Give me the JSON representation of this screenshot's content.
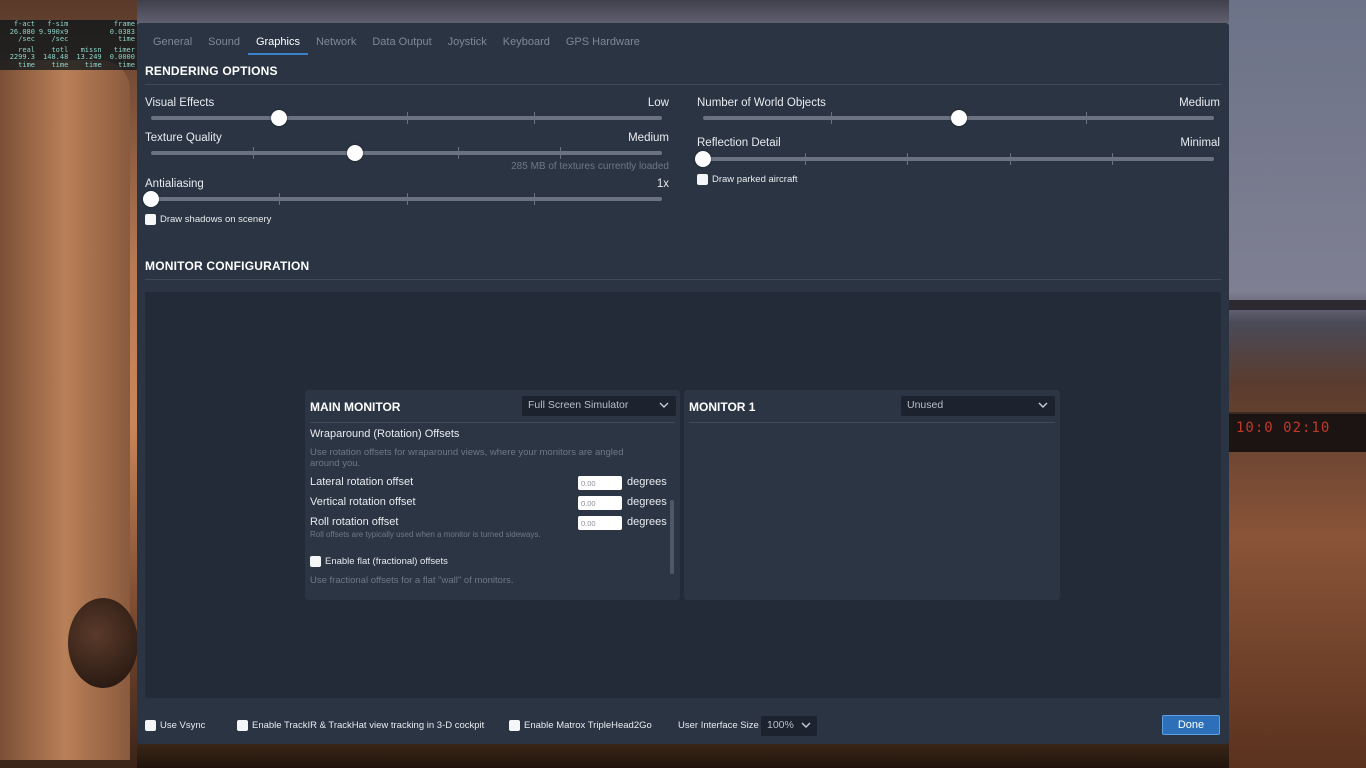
{
  "fps_overlay": {
    "rows": [
      [
        "f-act",
        "f-sim",
        "",
        "frame"
      ],
      [
        "26.080",
        "9.990x9",
        "",
        "0.0383"
      ],
      [
        "/sec",
        "/sec",
        "",
        "time"
      ],
      [
        "real",
        "totl",
        "missn",
        "timer"
      ],
      [
        "2299.3",
        "148.48",
        "13.249",
        "0.0000"
      ],
      [
        "time",
        "time",
        "time",
        "time"
      ]
    ]
  },
  "scene": {
    "readout": "10:0 02:10"
  },
  "tabs": [
    {
      "label": "General",
      "active": false
    },
    {
      "label": "Sound",
      "active": false
    },
    {
      "label": "Graphics",
      "active": true
    },
    {
      "label": "Network",
      "active": false
    },
    {
      "label": "Data Output",
      "active": false
    },
    {
      "label": "Joystick",
      "active": false
    },
    {
      "label": "Keyboard",
      "active": false
    },
    {
      "label": "GPS Hardware",
      "active": false
    }
  ],
  "rendering": {
    "title": "RENDERING OPTIONS",
    "visual_effects": {
      "label": "Visual Effects",
      "value": "Low",
      "level": 0.25
    },
    "texture_quality": {
      "label": "Texture Quality",
      "value": "Medium",
      "level": 0.4,
      "hint": "285 MB of textures currently loaded"
    },
    "antialiasing": {
      "label": "Antialiasing",
      "value": "1x",
      "level": 0.0
    },
    "draw_shadows": {
      "label": "Draw shadows on scenery",
      "checked": false
    },
    "world_objects": {
      "label": "Number of World Objects",
      "value": "Medium",
      "level": 0.5
    },
    "reflection_detail": {
      "label": "Reflection Detail",
      "value": "Minimal",
      "level": 0.0
    },
    "draw_parked": {
      "label": "Draw parked aircraft",
      "checked": false
    }
  },
  "monitor_config": {
    "title": "MONITOR CONFIGURATION",
    "main": {
      "title": "MAIN MONITOR",
      "mode": "Full Screen Simulator",
      "section": "Wraparound (Rotation) Offsets",
      "section_desc": "Use rotation offsets for wraparound views, where your monitors are angled around you.",
      "lateral": {
        "label": "Lateral rotation offset",
        "value": "0.00",
        "unit": "degrees"
      },
      "vertical": {
        "label": "Vertical rotation offset",
        "value": "0.00",
        "unit": "degrees"
      },
      "roll": {
        "label": "Roll rotation offset",
        "value": "0.00",
        "unit": "degrees",
        "desc": "Roll offsets are typically used when a monitor is turned sideways."
      },
      "flat": {
        "label": "Enable flat (fractional) offsets",
        "checked": false,
        "desc": "Use fractional offsets for a flat \"wall\" of monitors."
      }
    },
    "monitor1": {
      "title": "MONITOR 1",
      "mode": "Unused"
    }
  },
  "bottom": {
    "vsync": {
      "label": "Use Vsync",
      "checked": false
    },
    "trackir": {
      "label": "Enable TrackIR & TrackHat view tracking in 3-D cockpit",
      "checked": false
    },
    "matrox": {
      "label": "Enable Matrox TripleHead2Go",
      "checked": false
    },
    "ui_size_label": "User Interface Size",
    "ui_size_value": "100%",
    "done_label": "Done"
  },
  "colors": {
    "accent": "#2d6fb8",
    "dialog_bg": "#2b3442",
    "inner_bg": "#222b37"
  }
}
